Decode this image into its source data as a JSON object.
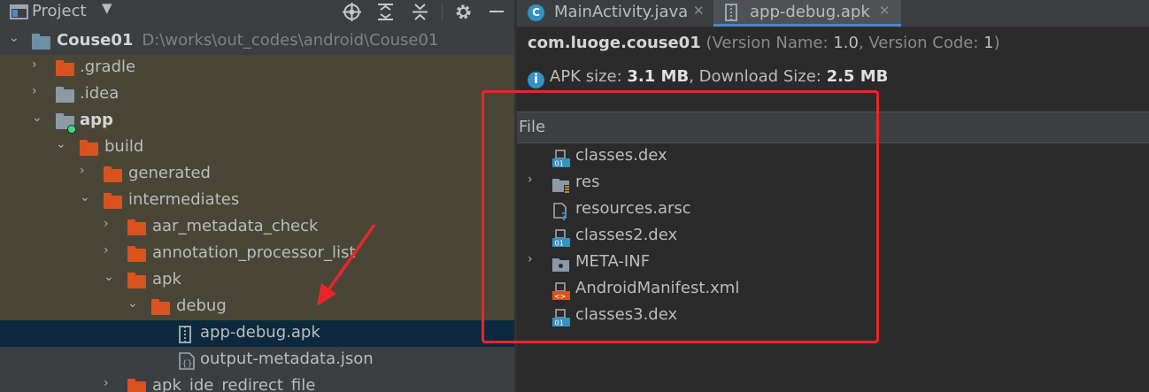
{
  "project_panel": {
    "title": "Project",
    "tree": [
      {
        "label": "Couse01",
        "path": "D:\\works\\out_codes\\android\\Couse01"
      },
      {
        "label": ".gradle"
      },
      {
        "label": ".idea"
      },
      {
        "label": "app"
      },
      {
        "label": "build"
      },
      {
        "label": "generated"
      },
      {
        "label": "intermediates"
      },
      {
        "label": "aar_metadata_check"
      },
      {
        "label": "annotation_processor_list"
      },
      {
        "label": "apk"
      },
      {
        "label": "debug"
      },
      {
        "label": "app-debug.apk"
      },
      {
        "label": "output-metadata.json"
      },
      {
        "label": "apk_ide_redirect_file"
      }
    ]
  },
  "editor": {
    "tabs": [
      {
        "label": "MainActivity.java",
        "icon": "java-class-icon"
      },
      {
        "label": "app-debug.apk",
        "icon": "apk-icon"
      }
    ],
    "apk_analyzer": {
      "package": "com.luoge.couse01",
      "version_open": "(Version Name: ",
      "version_name": "1.0",
      "version_mid": ", Version Code: ",
      "version_code": "1",
      "version_close": ")",
      "apk_size_label": "APK size: ",
      "apk_size": "3.1 MB",
      "download_size_label": ", Download Size: ",
      "download_size": "2.5 MB",
      "file_header": "File",
      "files": [
        {
          "label": "classes.dex",
          "icon": "dex-icon"
        },
        {
          "label": "res",
          "icon": "folder-icon"
        },
        {
          "label": "resources.arsc",
          "icon": "unknown-file-icon"
        },
        {
          "label": "classes2.dex",
          "icon": "dex-icon"
        },
        {
          "label": "META-INF",
          "icon": "folder-icon"
        },
        {
          "label": "AndroidManifest.xml",
          "icon": "xml-icon"
        },
        {
          "label": "classes3.dex",
          "icon": "dex-icon"
        }
      ]
    }
  },
  "colors": {
    "highlight_row": "#4a4637",
    "selected_row": "#0d293e",
    "folder_orange": "#d9531e",
    "annotation_red": "#e8262a",
    "tab_underline": "#4a88c7"
  }
}
